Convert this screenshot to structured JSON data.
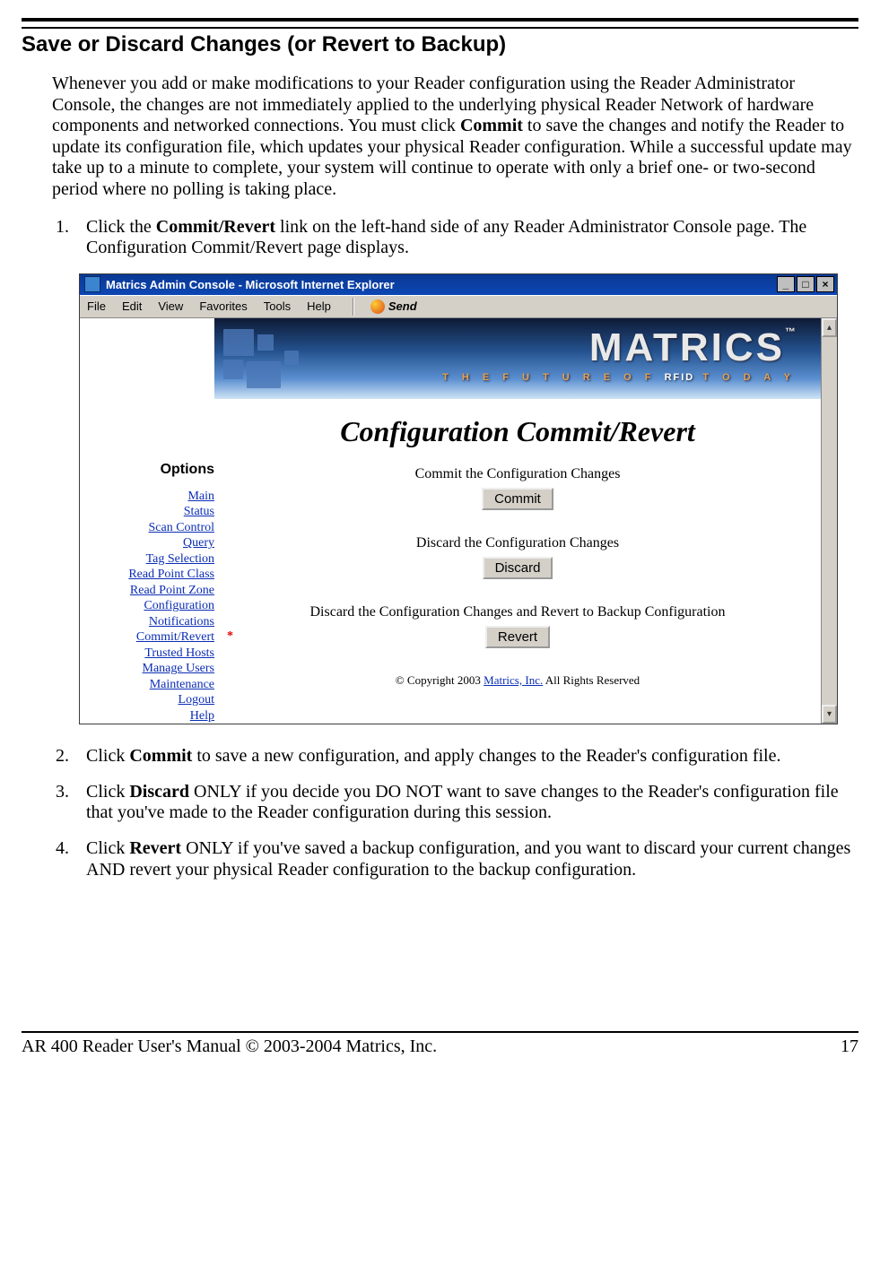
{
  "section_title": "Save or Discard Changes (or Revert to Backup)",
  "intro": {
    "pre_commit": "Whenever you add or make modifications to your Reader configuration using the Reader Administrator Console, the changes are not immediately applied to the underlying physical Reader Network of hardware components and networked connections. You must click ",
    "commit_word": "Commit",
    "post_commit": " to save the changes and notify the Reader to update its configuration file, which updates your physical Reader configuration. While a successful update may take up to a minute to complete, your system will continue to operate with only a brief one- or two-second period where no polling is taking place."
  },
  "step1": {
    "pre": "Click the ",
    "bold": "Commit/Revert",
    "post": " link on the left-hand side of any Reader Administrator Console page. The Configuration Commit/Revert page displays."
  },
  "step2": {
    "pre": "Click ",
    "bold": "Commit",
    "post": " to save a new configuration, and apply changes to the Reader's configuration file."
  },
  "step3": {
    "pre": "Click ",
    "bold": "Discard",
    "post": " ONLY if you decide you DO NOT want to save changes to the Reader's configuration file that you've made to the Reader configuration during this session."
  },
  "step4": {
    "pre": "Click ",
    "bold": "Revert",
    "post": " ONLY if you've saved a backup configuration, and you want to discard your current changes AND revert your physical Reader configuration to the backup configuration."
  },
  "ie": {
    "title": "Matrics Admin Console - Microsoft Internet Explorer",
    "menus": [
      "File",
      "Edit",
      "View",
      "Favorites",
      "Tools",
      "Help"
    ],
    "send_label": "Send",
    "brand": "MATRICS",
    "tagline": {
      "pre": "T H E   F U T U R E   O F  ",
      "bold": "RFID",
      "post": "  T O D A Y"
    },
    "options_hdr": "Options",
    "sidebar": [
      "Main",
      "Status",
      "Scan Control",
      "Query",
      "Tag Selection",
      "Read Point Class",
      "Read Point Zone",
      "Configuration",
      "Notifications",
      "Commit/Revert",
      "Trusted Hosts",
      "Manage Users",
      "Maintenance",
      "Logout",
      "Help"
    ],
    "sidebar_star_index": 9,
    "page_title": "Configuration Commit/Revert",
    "actions": {
      "commit": {
        "label": "Commit the Configuration Changes",
        "button": "Commit"
      },
      "discard": {
        "label": "Discard the Configuration Changes",
        "button": "Discard"
      },
      "revert": {
        "label": "Discard the Configuration Changes and Revert to Backup Configuration",
        "button": "Revert"
      }
    },
    "copyright": {
      "pre": "© Copyright 2003 ",
      "link": "Matrics, Inc.",
      "post": "  All Rights Reserved"
    }
  },
  "footer": {
    "left": "AR 400 Reader User's Manual © 2003-2004 Matrics, Inc.",
    "page": "17"
  }
}
